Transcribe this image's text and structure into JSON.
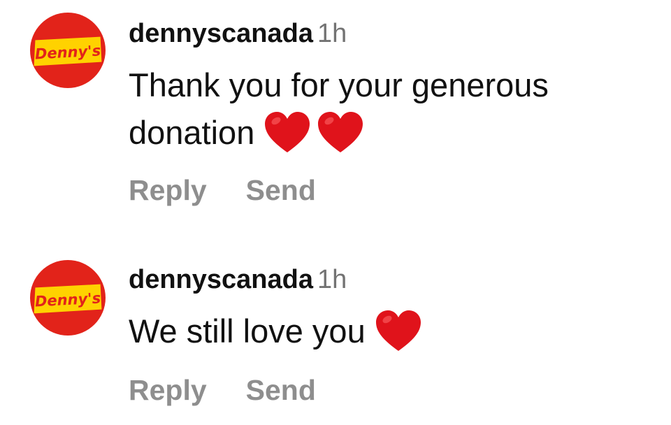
{
  "comments": [
    {
      "avatar_logo_text": "Denny's",
      "username": "dennyscanada",
      "timestamp": "1h",
      "text": "Thank you for your generous donation",
      "emojis": [
        "red-heart",
        "red-heart"
      ],
      "reply_label": "Reply",
      "send_label": "Send"
    },
    {
      "avatar_logo_text": "Denny's",
      "username": "dennyscanada",
      "timestamp": "1h",
      "text": "We still love you",
      "emojis": [
        "red-heart"
      ],
      "reply_label": "Reply",
      "send_label": "Send"
    }
  ],
  "colors": {
    "avatar_red": "#e2231a",
    "logo_yellow": "#ffd200",
    "heart_red": "#e0131b",
    "timestamp_gray": "#737373",
    "action_gray": "#8e8e8e"
  }
}
